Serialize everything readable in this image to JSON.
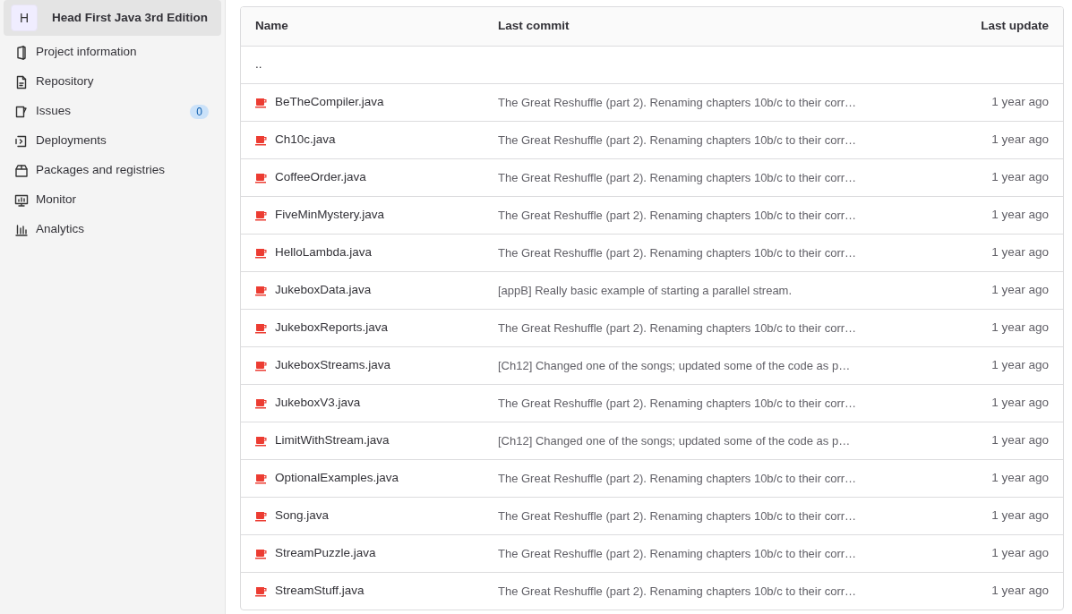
{
  "project": {
    "avatar": "H",
    "name": "Head First Java 3rd Edition",
    "selected": true
  },
  "sidebar": {
    "items": [
      {
        "label": "Project information"
      },
      {
        "label": "Repository"
      },
      {
        "label": "Issues",
        "count": "0"
      },
      {
        "label": "Deployments"
      },
      {
        "label": "Packages and registries"
      },
      {
        "label": "Monitor"
      },
      {
        "label": "Analytics"
      }
    ]
  },
  "table": {
    "columns": [
      "Name",
      "Last commit",
      "Last update"
    ],
    "parent_link": "..",
    "rows": [
      {
        "name": "BeTheCompiler.java",
        "commit": "The Great Reshuffle (part 2). Renaming chapters 10b/c to their corr…",
        "updated": "1 year ago"
      },
      {
        "name": "Ch10c.java",
        "commit": "The Great Reshuffle (part 2). Renaming chapters 10b/c to their corr…",
        "updated": "1 year ago"
      },
      {
        "name": "CoffeeOrder.java",
        "commit": "The Great Reshuffle (part 2). Renaming chapters 10b/c to their corr…",
        "updated": "1 year ago"
      },
      {
        "name": "FiveMinMystery.java",
        "commit": "The Great Reshuffle (part 2). Renaming chapters 10b/c to their corr…",
        "updated": "1 year ago"
      },
      {
        "name": "HelloLambda.java",
        "commit": "The Great Reshuffle (part 2). Renaming chapters 10b/c to their corr…",
        "updated": "1 year ago"
      },
      {
        "name": "JukeboxData.java",
        "commit": "[appB] Really basic example of starting a parallel stream.",
        "updated": "1 year ago"
      },
      {
        "name": "JukeboxReports.java",
        "commit": "The Great Reshuffle (part 2). Renaming chapters 10b/c to their corr…",
        "updated": "1 year ago"
      },
      {
        "name": "JukeboxStreams.java",
        "commit": "[Ch12] Changed one of the songs; updated some of the code as p…",
        "updated": "1 year ago"
      },
      {
        "name": "JukeboxV3.java",
        "commit": "The Great Reshuffle (part 2). Renaming chapters 10b/c to their corr…",
        "updated": "1 year ago"
      },
      {
        "name": "LimitWithStream.java",
        "commit": "[Ch12] Changed one of the songs; updated some of the code as p…",
        "updated": "1 year ago"
      },
      {
        "name": "OptionalExamples.java",
        "commit": "The Great Reshuffle (part 2). Renaming chapters 10b/c to their corr…",
        "updated": "1 year ago"
      },
      {
        "name": "Song.java",
        "commit": "The Great Reshuffle (part 2). Renaming chapters 10b/c to their corr…",
        "updated": "1 year ago"
      },
      {
        "name": "StreamPuzzle.java",
        "commit": "The Great Reshuffle (part 2). Renaming chapters 10b/c to their corr…",
        "updated": "1 year ago"
      },
      {
        "name": "StreamStuff.java",
        "commit": "The Great Reshuffle (part 2). Renaming chapters 10b/c to their corr…",
        "updated": "1 year ago"
      }
    ]
  }
}
